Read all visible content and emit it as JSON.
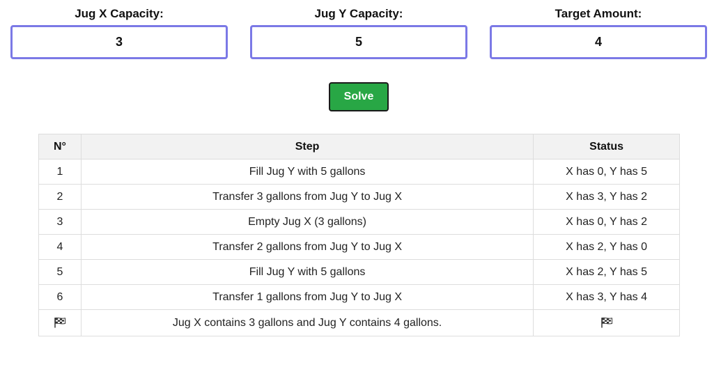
{
  "inputs": {
    "jug_x": {
      "label": "Jug X Capacity:",
      "value": "3"
    },
    "jug_y": {
      "label": "Jug Y Capacity:",
      "value": "5"
    },
    "target": {
      "label": "Target Amount:",
      "value": "4"
    }
  },
  "solve_button": {
    "label": "Solve",
    "color": "#28a745"
  },
  "table": {
    "headers": [
      "N°",
      "Step",
      "Status"
    ],
    "rows": [
      {
        "n": "1",
        "step": "Fill Jug Y with 5 gallons",
        "status": "X has 0, Y has 5"
      },
      {
        "n": "2",
        "step": "Transfer 3 gallons from Jug Y to Jug X",
        "status": "X has 3, Y has 2"
      },
      {
        "n": "3",
        "step": "Empty Jug X (3 gallons)",
        "status": "X has 0, Y has 2"
      },
      {
        "n": "4",
        "step": "Transfer 2 gallons from Jug Y to Jug X",
        "status": "X has 2, Y has 0"
      },
      {
        "n": "5",
        "step": "Fill Jug Y with 5 gallons",
        "status": "X has 2, Y has 5"
      },
      {
        "n": "6",
        "step": "Transfer 1 gallons from Jug Y to Jug X",
        "status": "X has 3, Y has 4"
      }
    ],
    "final": {
      "icon": "checkered-flag-icon",
      "message": "Jug X contains 3 gallons and Jug Y contains 4 gallons.",
      "status_icon": "checkered-flag-icon"
    }
  },
  "colors": {
    "input_border": "#7b79e6",
    "header_bg": "#f2f2f2",
    "grid": "#dddddd"
  }
}
